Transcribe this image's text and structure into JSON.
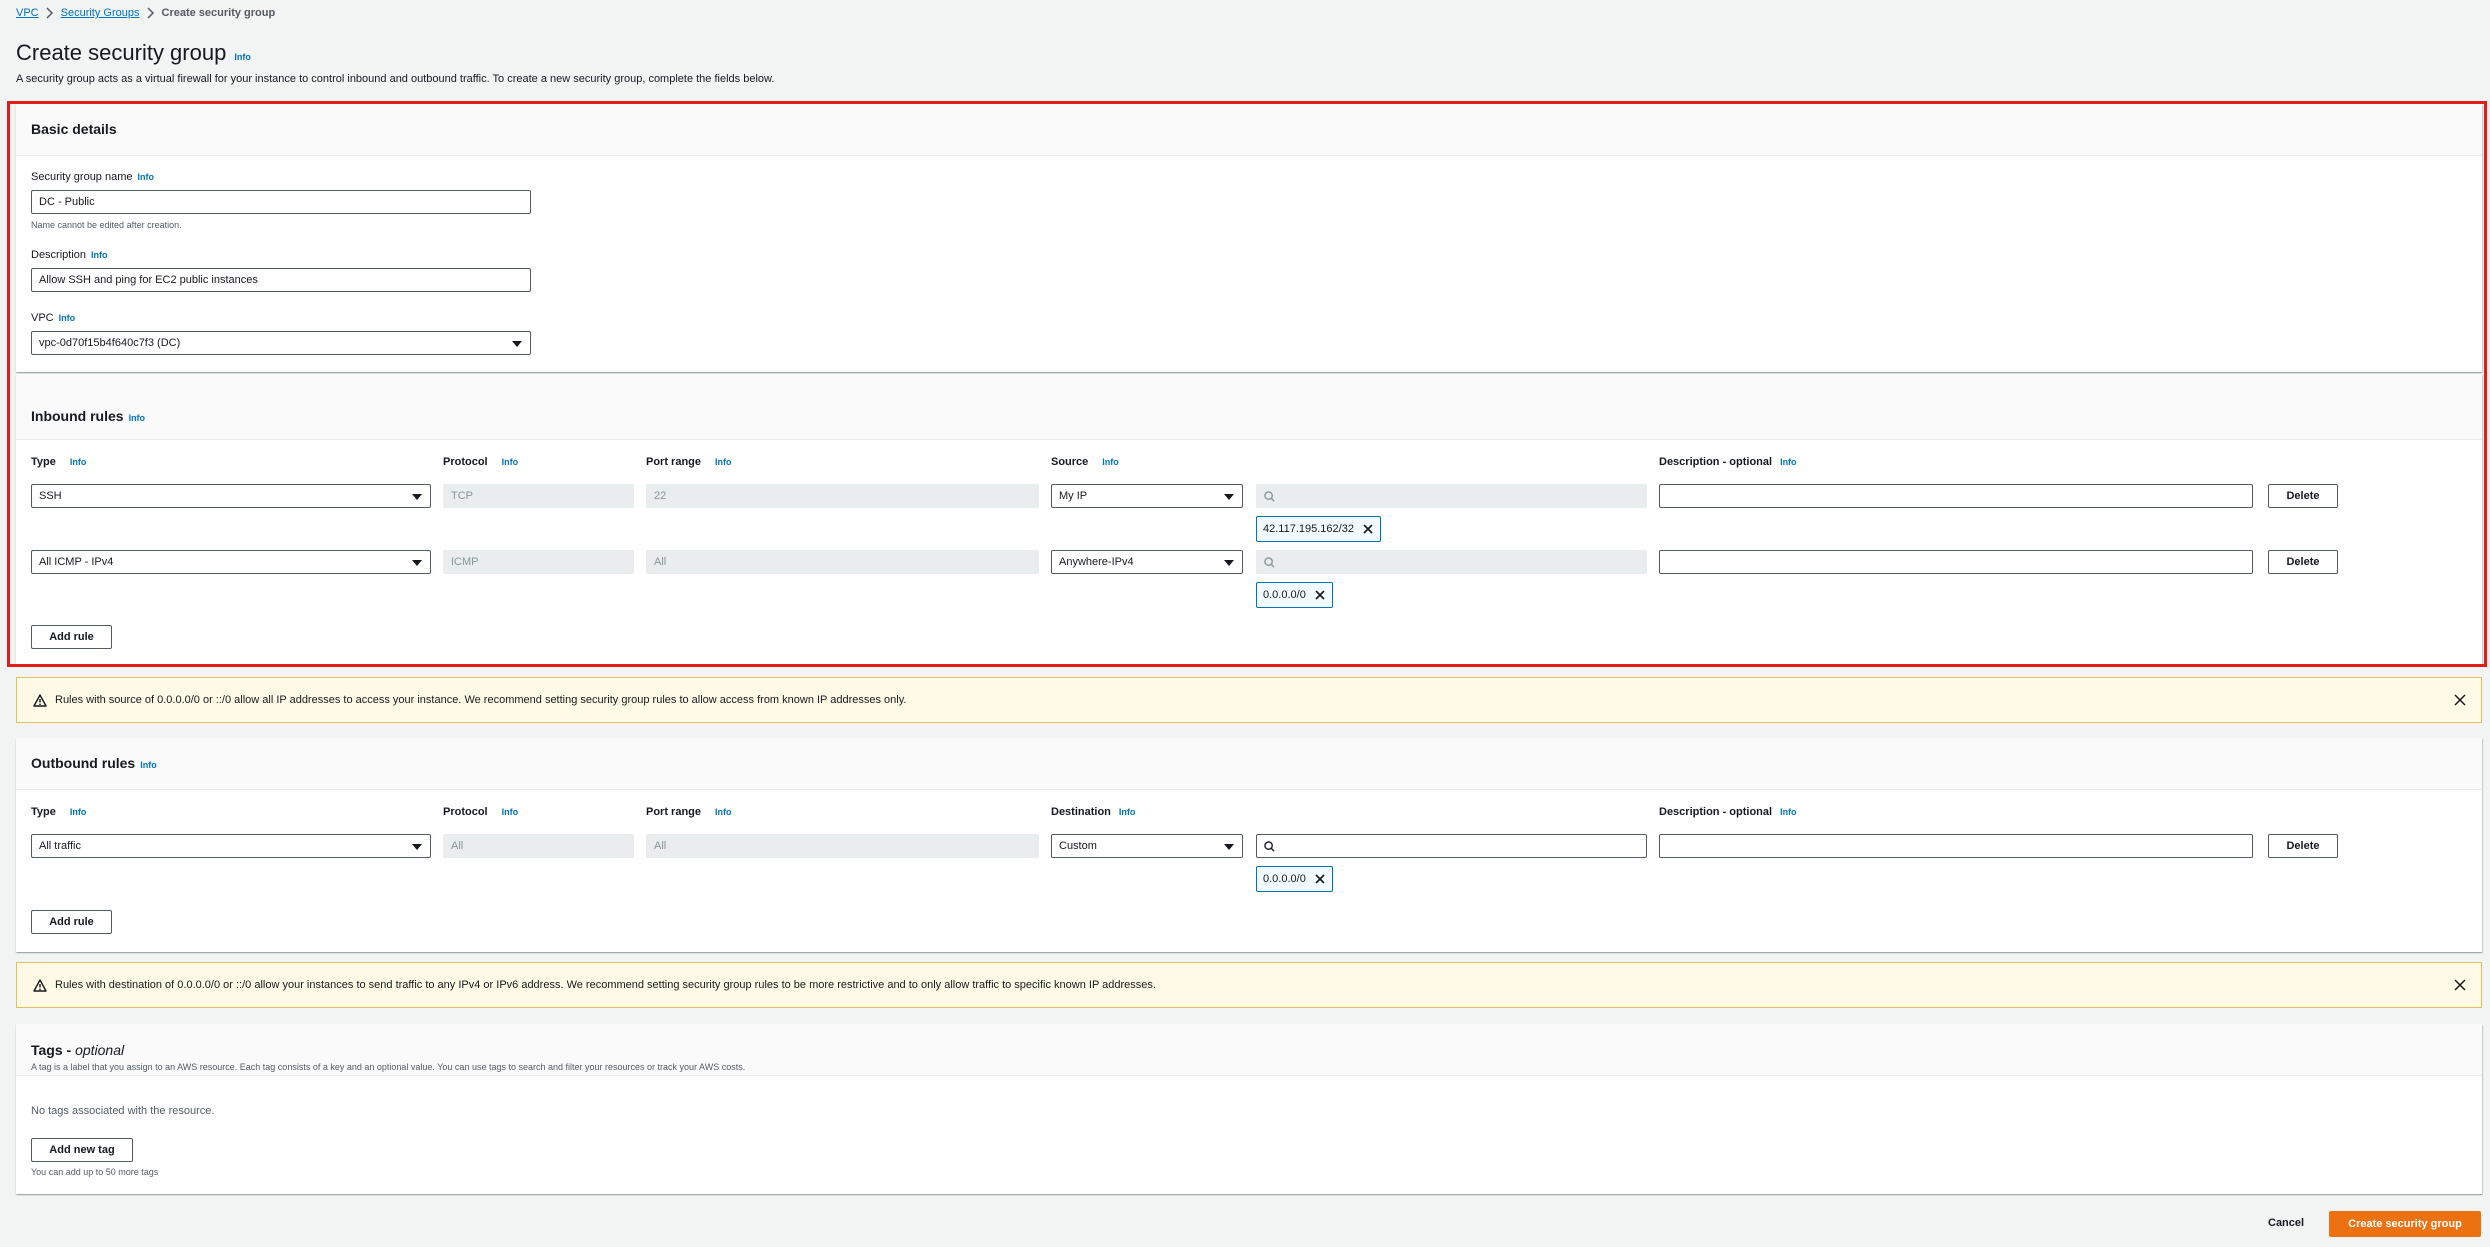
{
  "breadcrumb": {
    "vpc": "VPC",
    "security_groups": "Security Groups",
    "current": "Create security group"
  },
  "page": {
    "title": "Create security group",
    "info": "Info",
    "description": "A security group acts as a virtual firewall for your instance to control inbound and outbound traffic. To create a new security group, complete the fields below."
  },
  "basic": {
    "title": "Basic details",
    "name_label": "Security group name",
    "name_value": "DC - Public",
    "name_hint": "Name cannot be edited after creation.",
    "desc_label": "Description",
    "desc_value": "Allow SSH and ping for EC2 public instances",
    "vpc_label": "VPC",
    "vpc_value": "vpc-0d70f15b4f640c7f3 (DC)"
  },
  "inbound": {
    "title": "Inbound rules",
    "col_type": "Type",
    "col_protocol": "Protocol",
    "col_port": "Port range",
    "col_source": "Source",
    "col_desc": "Description - optional",
    "rules": [
      {
        "type": "SSH",
        "protocol": "TCP",
        "port": "22",
        "source": "My IP",
        "cidr": "42.117.195.162/32",
        "delete": "Delete"
      },
      {
        "type": "All ICMP - IPv4",
        "protocol": "ICMP",
        "port": "All",
        "source": "Anywhere-IPv4",
        "cidr": "0.0.0.0/0",
        "delete": "Delete"
      }
    ],
    "add_rule": "Add rule",
    "warning": "Rules with source of 0.0.0.0/0 or ::/0 allow all IP addresses to access your instance. We recommend setting security group rules to allow access from known IP addresses only."
  },
  "outbound": {
    "title": "Outbound rules",
    "col_type": "Type",
    "col_protocol": "Protocol",
    "col_port": "Port range",
    "col_dest": "Destination",
    "col_desc": "Description - optional",
    "rules": [
      {
        "type": "All traffic",
        "protocol": "All",
        "port": "All",
        "destination": "Custom",
        "cidr": "0.0.0.0/0",
        "delete": "Delete"
      }
    ],
    "add_rule": "Add rule",
    "warning": "Rules with destination of 0.0.0.0/0 or ::/0 allow your instances to send traffic to any IPv4 or IPv6 address. We recommend setting security group rules to be more restrictive and to only allow traffic to specific known IP addresses."
  },
  "tags": {
    "title": "Tags - ",
    "title_optional": "optional",
    "description": "A tag is a label that you assign to an AWS resource. Each tag consists of a key and an optional value. You can use tags to search and filter your resources or track your AWS costs.",
    "empty": "No tags associated with the resource.",
    "add_tag": "Add new tag",
    "hint": "You can add up to 50 more tags"
  },
  "footer": {
    "cancel": "Cancel",
    "create": "Create security group"
  },
  "colors": {
    "primary": "#ec7211",
    "link": "#0073bb",
    "highlight": "#e31b1b",
    "warning_bg": "#fffae6"
  }
}
